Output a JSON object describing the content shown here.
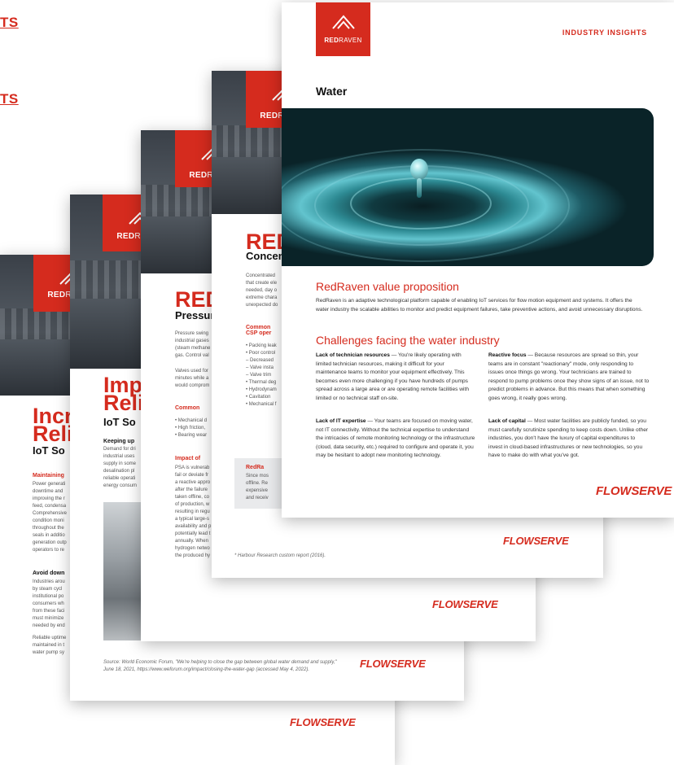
{
  "top_links": [
    "TS",
    "TS"
  ],
  "brand": {
    "name_bold": "RED",
    "name_light": "RAVEN",
    "name_full": "REDRAVEN"
  },
  "doc1": {
    "title": [
      "Incr",
      "Reli"
    ],
    "subtitle": "IoT So",
    "sections": [
      "Maintaining",
      "Avoid down"
    ],
    "para_frags": [
      "Power generati",
      "downtime and",
      "improving the r",
      "feed, condensa",
      "Comprehensive",
      "condition moni",
      "throughout the",
      "seals in additio",
      "generation outp",
      "operators to re"
    ],
    "para_frags2": [
      "Industries arou",
      "by steam cycl",
      "institutional po",
      "consumers wh",
      "from these faci",
      "must minimize",
      "needed by end"
    ],
    "para_frags3": [
      "Reliable uptime",
      "maintained in t",
      "water pump sy"
    ],
    "footer_brand": "FLOWSERVE"
  },
  "doc2": {
    "title": [
      "Impr",
      "Relia"
    ],
    "subtitle": "IoT So",
    "section": "Keeping up",
    "para_frags": [
      "Demand for dri",
      "industrial uses",
      "supply in some",
      "desalination pl",
      "reliable operati",
      "energy consum"
    ],
    "source": "Source: World Economic Forum, \"We're helping to close the gap between global water demand and supply,\" June 18, 2021, https://www.weforum.org/impact/closing-the-water-gap (accessed May 4, 2022).",
    "footer_brand": "FLOWSERVE"
  },
  "doc3": {
    "title": "REDR",
    "subtitle": "Pressur",
    "para_frags": [
      "Pressure swing",
      "industrial gases",
      "(steam methane",
      "gas. Control val"
    ],
    "para_frags2": [
      "Valves used for",
      "minutes while a",
      "would comprom"
    ],
    "section1": "Common",
    "bullets": [
      "• Mechanical d",
      "• High friction,",
      "• Bearing wear"
    ],
    "section2": "Impact of",
    "para_frags3": [
      "PSA is vulnerab",
      "fail or deviate fr",
      "a reactive appro",
      "after the failure",
      "taken offline, co",
      "of production, w",
      "resulting in regu",
      "a typical large-s",
      "availability and p",
      "potentially lead t",
      "annually. When",
      "hydrogen netwo",
      "the produced hy"
    ],
    "footer_brand": "FLOWSERVE"
  },
  "doc4": {
    "title": "REDR",
    "subtitle": "Concen",
    "para_frags": [
      "Concentrated",
      "that create ele",
      "needed, day o",
      "extreme chara",
      "unexpected do"
    ],
    "section": [
      "Common",
      "CSP oper"
    ],
    "bullets": [
      "• Packing leak",
      "• Poor control",
      "  – Decreased",
      "  – Valve insta",
      "  – Valve trim",
      "• Thermal deg",
      "• Hydrodynam",
      "• Cavitation",
      "• Mechanical f"
    ],
    "callout_title": "RedRa",
    "callout_frags": [
      "Since mos",
      "offline. Re",
      "expensive",
      "and receiv"
    ],
    "footnote": "* Harbour Research custom report (2016).",
    "footer_brand": "FLOWSERVE"
  },
  "front": {
    "tag": "INDUSTRY INSIGHTS",
    "title": "Water",
    "value_heading": "RedRaven value proposition",
    "value_text": "RedRaven is an adaptive technological platform capable of enabling IoT services for flow motion equipment and systems. It offers the water industry the scalable abilities to monitor and predict equipment failures, take preventive actions, and avoid unnecessary disruptions.",
    "challenges_heading": "Challenges facing the water industry",
    "items": [
      {
        "label": "Lack of technician resources",
        "text": " — You're likely operating with limited technician resources, making it difficult for your maintenance teams to monitor your equipment effectively. This becomes even more challenging if you have hundreds of pumps spread across a large area or are operating remote facilities with limited or no technical staff on-site."
      },
      {
        "label": "Reactive focus",
        "text": " — Because resources are spread so thin, your teams are in constant \"reactionary\" mode, only responding to issues once things go wrong. Your technicians are trained to respond to pump problems once they show signs of an issue, not to predict problems in advance. But this means that when something goes wrong, it really goes wrong."
      },
      {
        "label": "Lack of IT expertise",
        "text": " — Your teams are focused on moving water, not IT connectivity. Without the technical expertise to understand the intricacies of remote monitoring technology or the infrastructure (cloud, data security, etc.) required to configure and operate it, you may be hesitant to adopt new monitoring technology."
      },
      {
        "label": "Lack of capital",
        "text": " — Most water facilities are publicly funded, so you must carefully scrutinize spending to keep costs down. Unlike other industries, you don't have the luxury of capital expenditures to invest in cloud-based infrastructures or new technologies, so you have to make do with what you've got."
      }
    ],
    "footer_brand": "FLOWSERVE"
  }
}
